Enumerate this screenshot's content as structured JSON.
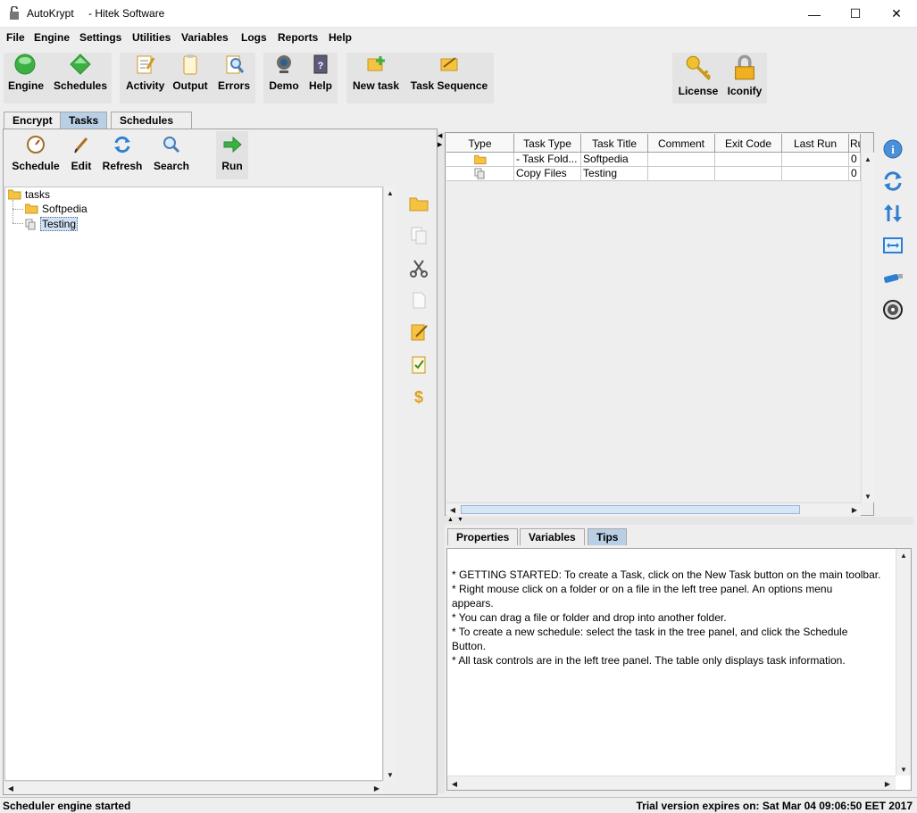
{
  "window": {
    "title": "AutoKrypt",
    "subtitle": "- Hitek Software",
    "minimize": "—",
    "maximize": "☐",
    "close": "✕"
  },
  "menu": [
    "File",
    "Engine",
    "Settings",
    "Utilities",
    "Variables",
    "Logs",
    "Reports",
    "Help"
  ],
  "toolbar": {
    "engine": "Engine",
    "schedules": "Schedules",
    "activity": "Activity",
    "output": "Output",
    "errors": "Errors",
    "demo": "Demo",
    "help": "Help",
    "new_task": "New task",
    "task_sequence": "Task Sequence",
    "license": "License",
    "iconify": "Iconify"
  },
  "main_tabs": [
    "Encrypt",
    "Tasks",
    "Schedules"
  ],
  "left_toolbar": {
    "schedule": "Schedule",
    "edit": "Edit",
    "refresh": "Refresh",
    "search": "Search",
    "run": "Run"
  },
  "tree": {
    "root": "tasks",
    "folder": "Softpedia",
    "file": "Testing"
  },
  "table": {
    "headers": [
      "Type",
      "Task Type",
      "Task Title",
      "Comment",
      "Exit Code",
      "Last Run",
      "Ru"
    ],
    "rows": [
      {
        "type_icon": "folder-icon",
        "task_type": "- Task Fold...",
        "task_title": "Softpedia",
        "comment": "",
        "exit_code": "",
        "last_run": "",
        "runs": "0"
      },
      {
        "type_icon": "copy-files-icon",
        "task_type": "Copy Files",
        "task_title": "Testing",
        "comment": "",
        "exit_code": "",
        "last_run": "",
        "runs": "0"
      }
    ]
  },
  "bottom_tabs": [
    "Properties",
    "Variables",
    "Tips"
  ],
  "tips": [
    "*  GETTING STARTED: To create a Task, click on the New Task button on the main toolbar.",
    "*  Right mouse click on a folder or on a file in the left tree panel.  An options menu",
    "appears.",
    "*  You can drag a file or folder and drop into another folder.",
    "*  To create a new schedule: select the task in the tree panel, and click the Schedule",
    "Button.",
    "*  All task controls are in the left tree panel.  The table only displays task information."
  ],
  "status": {
    "left": "Scheduler engine started",
    "right": "Trial version expires on: Sat Mar 04 09:06:50 EET 2017"
  },
  "colors": {
    "selected_tab": "#b8cfe5",
    "window_bg": "#eeeeee",
    "folder": "#f5c242",
    "engine_green": "#3cb043"
  }
}
